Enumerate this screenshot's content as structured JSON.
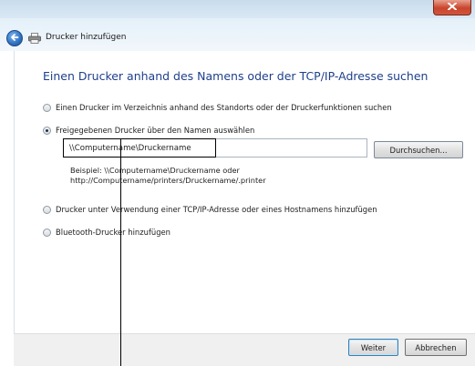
{
  "window": {
    "title": "Drucker hinzufügen",
    "accent": "#1e3f8c",
    "close_color": "#c8452c"
  },
  "icons": {
    "close": "close-icon",
    "back": "back-arrow-icon",
    "printer": "printer-icon"
  },
  "main": {
    "heading": "Einen Drucker anhand des Namens oder der TCP/IP-Adresse suchen",
    "options": [
      {
        "label": "Einen Drucker im Verzeichnis anhand des Standorts oder der Druckerfunktionen suchen",
        "checked": false
      },
      {
        "label": "Freigegebenen Drucker über den Namen auswählen",
        "checked": true
      },
      {
        "label": "Drucker unter Verwendung einer TCP/IP-Adresse oder eines Hostnamens hinzufügen",
        "checked": false
      },
      {
        "label": "Bluetooth-Drucker hinzufügen",
        "checked": false
      }
    ],
    "share_input_value": "\\\\Computername\\Druckername",
    "browse_label": "Durchsuchen...",
    "example_line1": "Beispiel: \\\\Computername\\Druckername oder",
    "example_line2": "http://Computername/printers/Druckername/.printer"
  },
  "footer": {
    "next_label": "Weiter",
    "cancel_label": "Abbrechen"
  }
}
